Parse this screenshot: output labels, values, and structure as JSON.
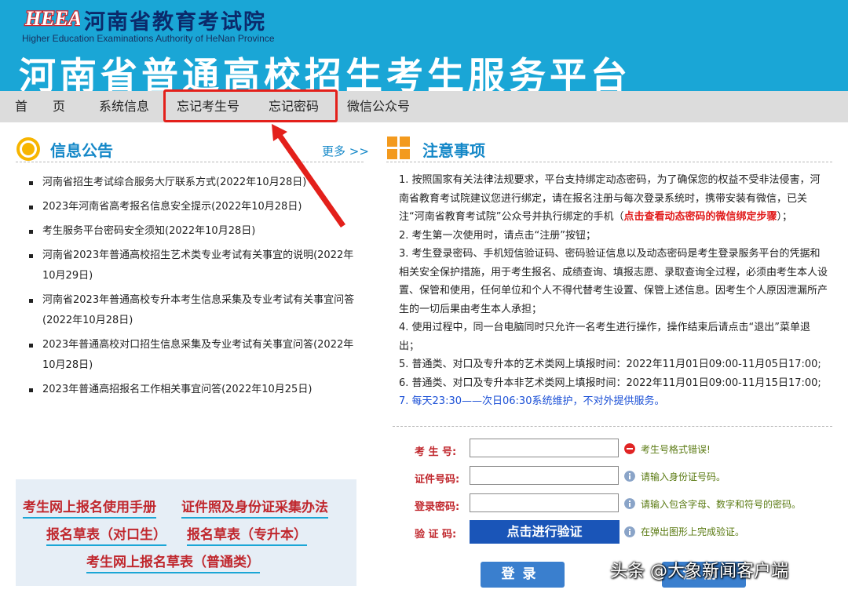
{
  "header": {
    "org_name": "河南省教育考试院",
    "org_en": "Higher Education Examinations Authority of HeNan Province",
    "platform_title": "河南省普通高校招生考生服务平台",
    "logo_text": "HEEA"
  },
  "nav": {
    "items": [
      "首　　页",
      "系统信息",
      "忘记考生号",
      "忘记密码",
      "微信公众号"
    ]
  },
  "news": {
    "title": "信息公告",
    "more": "更多 >>",
    "items": [
      "河南省招生考试综合服务大厅联系方式(2022年10月28日)",
      "2023年河南省高考报名信息安全提示(2022年10月28日)",
      "考生服务平台密码安全须知(2022年10月28日)",
      "河南省2023年普通高校招生艺术类专业考试有关事宜的说明(2022年10月29日)",
      "河南省2023年普通高校专升本考生信息采集及专业考试有关事宜问答(2022年10月28日)",
      "2023年普通高校对口招生信息采集及专业考试有关事宜问答(2022年10月28日)",
      "2023年普通高招报名工作相关事宜问答(2022年10月25日)"
    ]
  },
  "manuals": {
    "link1": "考生网上报名使用手册",
    "link2": "证件照及身份证采集办法",
    "link3": "报名草表（对口生）",
    "link4": "报名草表（专升本）",
    "link5": "考生网上报名草表（普通类）"
  },
  "notice": {
    "title": "注意事项",
    "item1_a": "1. 按照国家有关法律法规要求，平台支持绑定动态密码，为了确保您的权益不受非法侵害，河南省教育考试院建议您进行绑定，请在报名注册与每次登录系统时，携带安装有微信，已关注“河南省教育考试院”公众号并执行绑定的手机（",
    "item1_link": "点击查看动态密码的微信绑定步骤",
    "item1_b": "）；",
    "item2": "2. 考生第一次使用时，请点击“注册”按钮；",
    "item3": "3. 考生登录密码、手机短信验证码、密码验证信息以及动态密码是考生登录服务平台的凭据和相关安全保护措施，用于考生报名、成绩查询、填报志愿、录取查询全过程，必须由考生本人设置、保管和使用，任何单位和个人不得代替考生设置、保管上述信息。因考生个人原因泄漏所产生的一切后果由考生本人承担；",
    "item4": "4. 使用过程中，同一台电脑同时只允许一名考生进行操作，操作结束后请点击“退出”菜单退出；",
    "item5": "5. 普通类、对口及专升本的艺术类网上填报时间：2022年11月01日09:00-11月05日17:00;",
    "item6": "6. 普通类、对口及专升本非艺术类网上填报时间：2022年11月01日09:00-11月15日17:00;",
    "item7": "7. 每天23:30——次日06:30系统维护，不对外提供服务。"
  },
  "form": {
    "label_exam_no": "考 生 号:",
    "label_id": "证件号码:",
    "label_password": "登录密码:",
    "label_captcha": "验 证 码:",
    "hint_exam_no": "考生号格式错误!",
    "hint_id": "请输入身份证号码。",
    "hint_password": "请输入包含字母、数字和符号的密码。",
    "hint_captcha": "在弹出图形上完成验证。",
    "verify_button": "点击进行验证",
    "login_button": "登录",
    "reset_button": "注册"
  },
  "watermark": "头条 @大象新闻客户端",
  "colors": {
    "header_bg": "#1aa6d6",
    "accent_blue": "#1588c8",
    "error_red": "#c0272d",
    "highlight_red": "#e3201b"
  }
}
